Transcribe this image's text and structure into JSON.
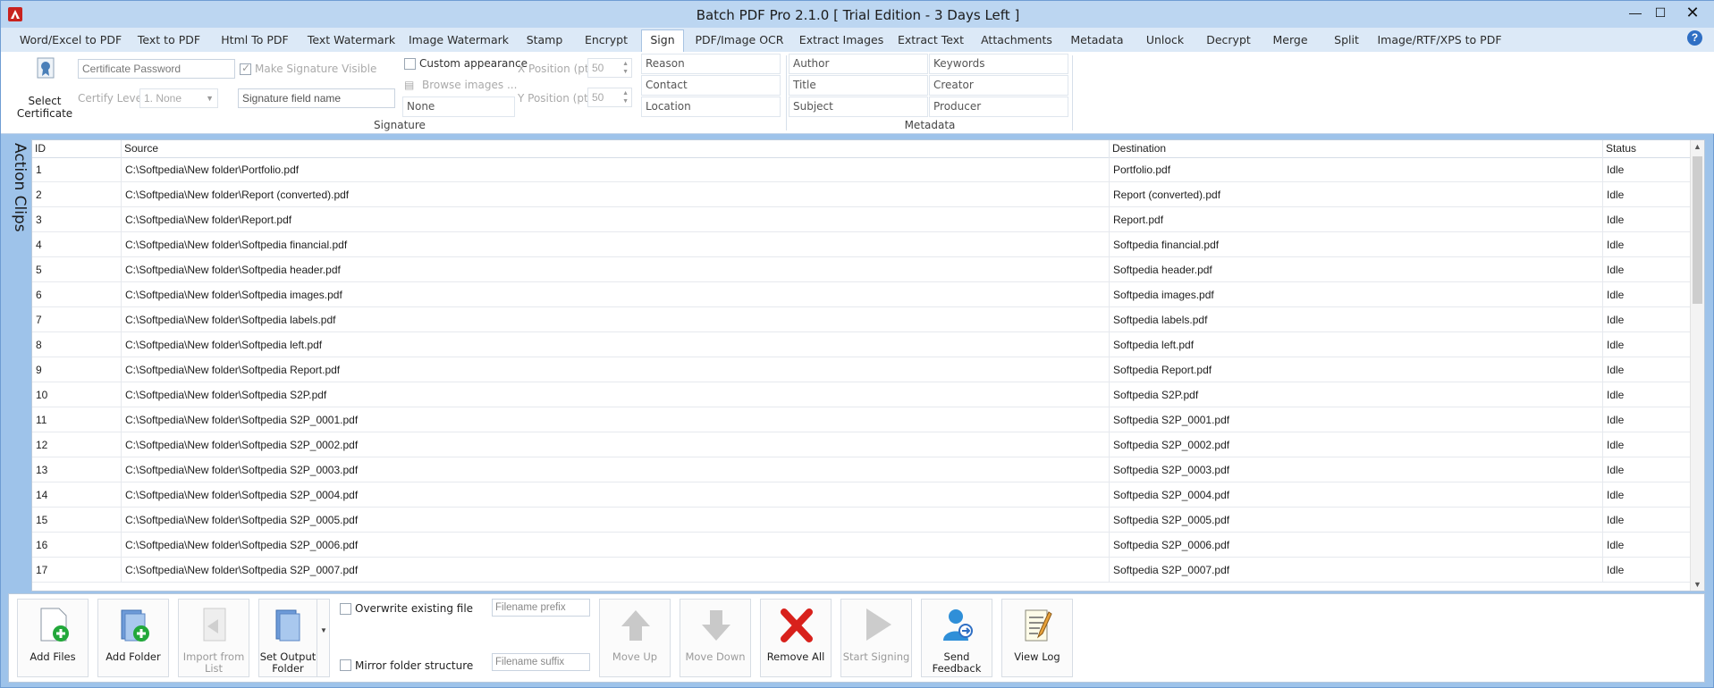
{
  "window": {
    "title": "Batch PDF Pro 2.1.0 [ Trial Edition - 3 Days Left ]",
    "controls": {
      "minimize": "—",
      "maximize": "☐",
      "close": "✕"
    }
  },
  "tabs": [
    {
      "label": "Word/Excel to PDF",
      "active": false
    },
    {
      "label": "Text to PDF",
      "active": false
    },
    {
      "label": "Html To PDF",
      "active": false
    },
    {
      "label": "Text Watermark",
      "active": false
    },
    {
      "label": "Image Watermark",
      "active": false
    },
    {
      "label": "Stamp",
      "active": false
    },
    {
      "label": "Encrypt",
      "active": false
    },
    {
      "label": "Sign",
      "active": true
    },
    {
      "label": "PDF/Image OCR",
      "active": false
    },
    {
      "label": "Extract Images",
      "active": false
    },
    {
      "label": "Extract Text",
      "active": false
    },
    {
      "label": "Attachments",
      "active": false
    },
    {
      "label": "Metadata",
      "active": false
    },
    {
      "label": "Unlock",
      "active": false
    },
    {
      "label": "Decrypt",
      "active": false
    },
    {
      "label": "Merge",
      "active": false
    },
    {
      "label": "Split",
      "active": false
    },
    {
      "label": "Image/RTF/XPS to PDF",
      "active": false
    }
  ],
  "help_icon": "?",
  "ribbon": {
    "select_certificate": "Select Certificate",
    "certificate_password": "Certificate Password",
    "make_signature_visible": "Make Signature Visible",
    "certify_level_label": "Certify Level",
    "certify_level_value": "1. None",
    "signature_field_name": "Signature field name",
    "custom_appearance": "Custom appearance",
    "browse_images": "Browse images ...",
    "image_value": "None",
    "x_position_label": "X Position (pt)",
    "x_position_value": "50",
    "y_position_label": "Y Position (pt)",
    "y_position_value": "50",
    "reason": "Reason",
    "contact": "Contact",
    "location": "Location",
    "signature_group": "Signature",
    "author": "Author",
    "title": "Title",
    "subject": "Subject",
    "keywords": "Keywords",
    "creator": "Creator",
    "producer": "Producer",
    "metadata_group": "Metadata"
  },
  "side_label": "Action Clips",
  "grid": {
    "columns": [
      "ID",
      "Source",
      "Destination",
      "Status"
    ],
    "rows": [
      [
        "1",
        "C:\\Softpedia\\New folder\\Portfolio.pdf",
        "Portfolio.pdf",
        "Idle"
      ],
      [
        "2",
        "C:\\Softpedia\\New folder\\Report (converted).pdf",
        "Report (converted).pdf",
        "Idle"
      ],
      [
        "3",
        "C:\\Softpedia\\New folder\\Report.pdf",
        "Report.pdf",
        "Idle"
      ],
      [
        "4",
        "C:\\Softpedia\\New folder\\Softpedia financial.pdf",
        "Softpedia financial.pdf",
        "Idle"
      ],
      [
        "5",
        "C:\\Softpedia\\New folder\\Softpedia header.pdf",
        "Softpedia header.pdf",
        "Idle"
      ],
      [
        "6",
        "C:\\Softpedia\\New folder\\Softpedia images.pdf",
        "Softpedia images.pdf",
        "Idle"
      ],
      [
        "7",
        "C:\\Softpedia\\New folder\\Softpedia labels.pdf",
        "Softpedia labels.pdf",
        "Idle"
      ],
      [
        "8",
        "C:\\Softpedia\\New folder\\Softpedia left.pdf",
        "Softpedia left.pdf",
        "Idle"
      ],
      [
        "9",
        "C:\\Softpedia\\New folder\\Softpedia Report.pdf",
        "Softpedia Report.pdf",
        "Idle"
      ],
      [
        "10",
        "C:\\Softpedia\\New folder\\Softpedia S2P.pdf",
        "Softpedia S2P.pdf",
        "Idle"
      ],
      [
        "11",
        "C:\\Softpedia\\New folder\\Softpedia S2P_0001.pdf",
        "Softpedia S2P_0001.pdf",
        "Idle"
      ],
      [
        "12",
        "C:\\Softpedia\\New folder\\Softpedia S2P_0002.pdf",
        "Softpedia S2P_0002.pdf",
        "Idle"
      ],
      [
        "13",
        "C:\\Softpedia\\New folder\\Softpedia S2P_0003.pdf",
        "Softpedia S2P_0003.pdf",
        "Idle"
      ],
      [
        "14",
        "C:\\Softpedia\\New folder\\Softpedia S2P_0004.pdf",
        "Softpedia S2P_0004.pdf",
        "Idle"
      ],
      [
        "15",
        "C:\\Softpedia\\New folder\\Softpedia S2P_0005.pdf",
        "Softpedia S2P_0005.pdf",
        "Idle"
      ],
      [
        "16",
        "C:\\Softpedia\\New folder\\Softpedia S2P_0006.pdf",
        "Softpedia S2P_0006.pdf",
        "Idle"
      ],
      [
        "17",
        "C:\\Softpedia\\New folder\\Softpedia S2P_0007.pdf",
        "Softpedia S2P_0007.pdf",
        "Idle"
      ]
    ]
  },
  "toolbar": {
    "add_files": "Add Files",
    "add_folder": "Add Folder",
    "import_from_list": "Import from List",
    "set_output_folder": "Set Output Folder",
    "overwrite_existing_file": "Overwrite existing file",
    "mirror_folder_structure": "Mirror folder structure",
    "filename_prefix": "Filename prefix",
    "filename_suffix": "Filename suffix",
    "move_up": "Move Up",
    "move_down": "Move Down",
    "remove_all": "Remove All",
    "start_signing": "Start Signing",
    "send_feedback": "Send Feedback",
    "view_log": "View Log"
  },
  "colors": {
    "frame": "#9ec3ea",
    "titlebar": "#bcd6f1",
    "tabbar": "#dce9f7",
    "accent": "#2f6fc4",
    "remove_red": "#d8211c",
    "add_green": "#22a83a"
  }
}
